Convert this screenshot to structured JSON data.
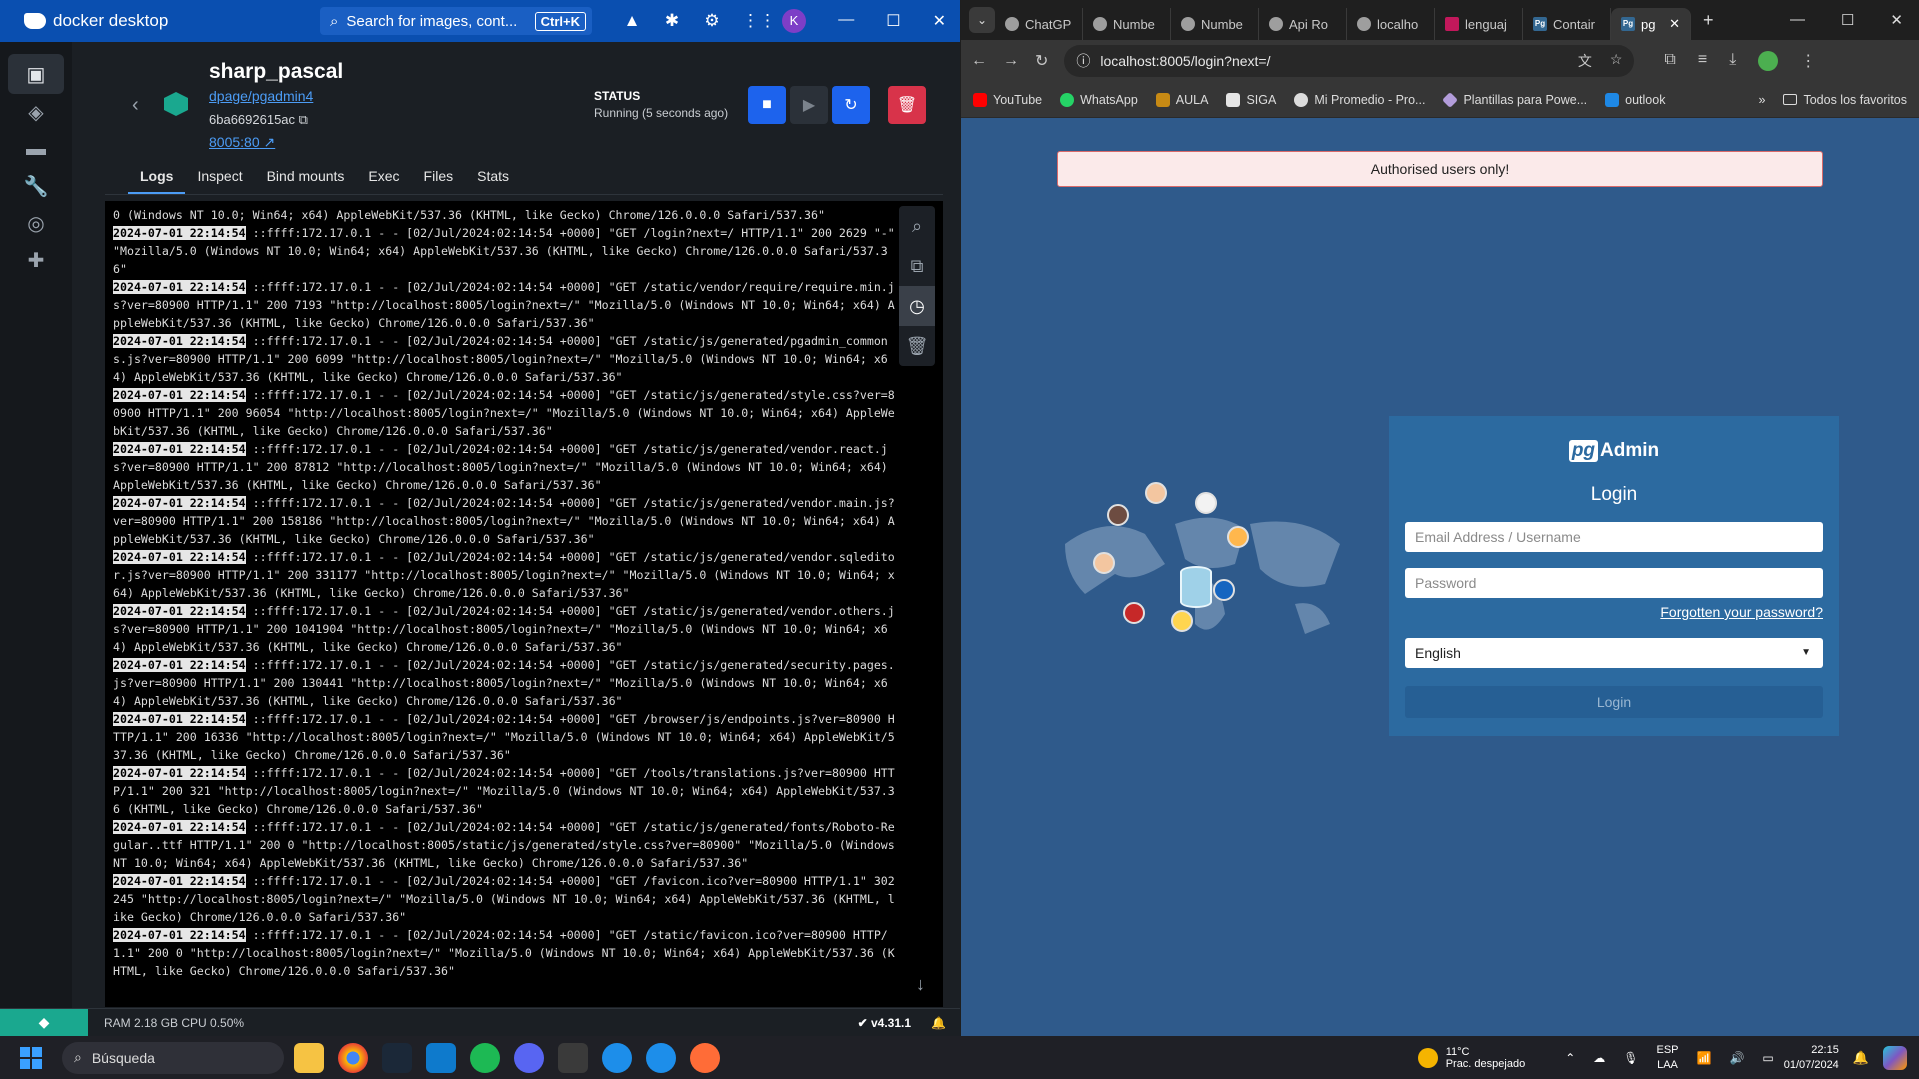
{
  "docker": {
    "brand": "docker desktop",
    "search_placeholder": "Search for images, cont...",
    "search_shortcut": "Ctrl+K",
    "avatar_letter": "K",
    "container": {
      "name": "sharp_pascal",
      "image_link": "dpage/pgadmin4",
      "id": "6ba6692615ac",
      "port_link": "8005:80",
      "status_label": "STATUS",
      "status_value": "Running (5 seconds ago)"
    },
    "tabs": [
      "Logs",
      "Inspect",
      "Bind mounts",
      "Exec",
      "Files",
      "Stats"
    ],
    "active_tab": "Logs",
    "log_prefix": "0 (Windows NT 10.0; Win64; x64) AppleWebKit/537.36 (KHTML, like Gecko) Chrome/126.0.0.0 Safari/537.36\"",
    "logs": [
      {
        "ts": "2024-07-01 22:14:54",
        "msg": " ::ffff:172.17.0.1 - - [02/Jul/2024:02:14:54 +0000] \"GET /login?next=/ HTTP/1.1\" 200 2629 \"-\" \"Mozilla/5.0 (Windows NT 10.0; Win64; x64) AppleWebKit/537.36 (KHTML, like Gecko) Chrome/126.0.0.0 Safari/537.36\""
      },
      {
        "ts": "2024-07-01 22:14:54",
        "msg": " ::ffff:172.17.0.1 - - [02/Jul/2024:02:14:54 +0000] \"GET /static/vendor/require/require.min.js?ver=80900 HTTP/1.1\" 200 7193 \"http://localhost:8005/login?next=/\" \"Mozilla/5.0 (Windows NT 10.0; Win64; x64) AppleWebKit/537.36 (KHTML, like Gecko) Chrome/126.0.0.0 Safari/537.36\""
      },
      {
        "ts": "2024-07-01 22:14:54",
        "msg": " ::ffff:172.17.0.1 - - [02/Jul/2024:02:14:54 +0000] \"GET /static/js/generated/pgadmin_commons.js?ver=80900 HTTP/1.1\" 200 6099 \"http://localhost:8005/login?next=/\" \"Mozilla/5.0 (Windows NT 10.0; Win64; x64) AppleWebKit/537.36 (KHTML, like Gecko) Chrome/126.0.0.0 Safari/537.36\""
      },
      {
        "ts": "2024-07-01 22:14:54",
        "msg": " ::ffff:172.17.0.1 - - [02/Jul/2024:02:14:54 +0000] \"GET /static/js/generated/style.css?ver=80900 HTTP/1.1\" 200 96054 \"http://localhost:8005/login?next=/\" \"Mozilla/5.0 (Windows NT 10.0; Win64; x64) AppleWebKit/537.36 (KHTML, like Gecko) Chrome/126.0.0.0 Safari/537.36\""
      },
      {
        "ts": "2024-07-01 22:14:54",
        "msg": " ::ffff:172.17.0.1 - - [02/Jul/2024:02:14:54 +0000] \"GET /static/js/generated/vendor.react.js?ver=80900 HTTP/1.1\" 200 87812 \"http://localhost:8005/login?next=/\" \"Mozilla/5.0 (Windows NT 10.0; Win64; x64) AppleWebKit/537.36 (KHTML, like Gecko) Chrome/126.0.0.0 Safari/537.36\""
      },
      {
        "ts": "2024-07-01 22:14:54",
        "msg": " ::ffff:172.17.0.1 - - [02/Jul/2024:02:14:54 +0000] \"GET /static/js/generated/vendor.main.js?ver=80900 HTTP/1.1\" 200 158186 \"http://localhost:8005/login?next=/\" \"Mozilla/5.0 (Windows NT 10.0; Win64; x64) AppleWebKit/537.36 (KHTML, like Gecko) Chrome/126.0.0.0 Safari/537.36\""
      },
      {
        "ts": "2024-07-01 22:14:54",
        "msg": " ::ffff:172.17.0.1 - - [02/Jul/2024:02:14:54 +0000] \"GET /static/js/generated/vendor.sqleditor.js?ver=80900 HTTP/1.1\" 200 331177 \"http://localhost:8005/login?next=/\" \"Mozilla/5.0 (Windows NT 10.0; Win64; x64) AppleWebKit/537.36 (KHTML, like Gecko) Chrome/126.0.0.0 Safari/537.36\""
      },
      {
        "ts": "2024-07-01 22:14:54",
        "msg": " ::ffff:172.17.0.1 - - [02/Jul/2024:02:14:54 +0000] \"GET /static/js/generated/vendor.others.js?ver=80900 HTTP/1.1\" 200 1041904 \"http://localhost:8005/login?next=/\" \"Mozilla/5.0 (Windows NT 10.0; Win64; x64) AppleWebKit/537.36 (KHTML, like Gecko) Chrome/126.0.0.0 Safari/537.36\""
      },
      {
        "ts": "2024-07-01 22:14:54",
        "msg": " ::ffff:172.17.0.1 - - [02/Jul/2024:02:14:54 +0000] \"GET /static/js/generated/security.pages.js?ver=80900 HTTP/1.1\" 200 130441 \"http://localhost:8005/login?next=/\" \"Mozilla/5.0 (Windows NT 10.0; Win64; x64) AppleWebKit/537.36 (KHTML, like Gecko) Chrome/126.0.0.0 Safari/537.36\""
      },
      {
        "ts": "2024-07-01 22:14:54",
        "msg": " ::ffff:172.17.0.1 - - [02/Jul/2024:02:14:54 +0000] \"GET /browser/js/endpoints.js?ver=80900 HTTP/1.1\" 200 16336 \"http://localhost:8005/login?next=/\" \"Mozilla/5.0 (Windows NT 10.0; Win64; x64) AppleWebKit/537.36 (KHTML, like Gecko) Chrome/126.0.0.0 Safari/537.36\""
      },
      {
        "ts": "2024-07-01 22:14:54",
        "msg": " ::ffff:172.17.0.1 - - [02/Jul/2024:02:14:54 +0000] \"GET /tools/translations.js?ver=80900 HTTP/1.1\" 200 321 \"http://localhost:8005/login?next=/\" \"Mozilla/5.0 (Windows NT 10.0; Win64; x64) AppleWebKit/537.36 (KHTML, like Gecko) Chrome/126.0.0.0 Safari/537.36\""
      },
      {
        "ts": "2024-07-01 22:14:54",
        "msg": " ::ffff:172.17.0.1 - - [02/Jul/2024:02:14:54 +0000] \"GET /static/js/generated/fonts/Roboto-Regular..ttf HTTP/1.1\" 200 0 \"http://localhost:8005/static/js/generated/style.css?ver=80900\" \"Mozilla/5.0 (Windows NT 10.0; Win64; x64) AppleWebKit/537.36 (KHTML, like Gecko) Chrome/126.0.0.0 Safari/537.36\""
      },
      {
        "ts": "2024-07-01 22:14:54",
        "msg": " ::ffff:172.17.0.1 - - [02/Jul/2024:02:14:54 +0000] \"GET /favicon.ico?ver=80900 HTTP/1.1\" 302 245 \"http://localhost:8005/login?next=/\" \"Mozilla/5.0 (Windows NT 10.0; Win64; x64) AppleWebKit/537.36 (KHTML, like Gecko) Chrome/126.0.0.0 Safari/537.36\""
      },
      {
        "ts": "2024-07-01 22:14:54",
        "msg": " ::ffff:172.17.0.1 - - [02/Jul/2024:02:14:54 +0000] \"GET /static/favicon.ico?ver=80900 HTTP/1.1\" 200 0 \"http://localhost:8005/login?next=/\" \"Mozilla/5.0 (Windows NT 10.0; Win64; x64) AppleWebKit/537.36 (KHTML, like Gecko) Chrome/126.0.0.0 Safari/537.36\""
      }
    ],
    "footer": {
      "resources": "RAM 2.18 GB  CPU 0.50%",
      "version": "v4.31.1"
    }
  },
  "chrome": {
    "tabs": [
      {
        "label": "ChatGP",
        "icon": "chatgpt-icon"
      },
      {
        "label": "Numbe",
        "icon": "globe-icon"
      },
      {
        "label": "Numbe",
        "icon": "globe-icon"
      },
      {
        "label": "Api Ro",
        "icon": "globe-icon"
      },
      {
        "label": "localho",
        "icon": "globe-icon"
      },
      {
        "label": "lenguaj",
        "icon": "pink-icon"
      },
      {
        "label": "Contair",
        "icon": "pgadmin-icon"
      },
      {
        "label": "pg",
        "icon": "pgadmin-icon"
      }
    ],
    "url": "localhost:8005/login?next=/",
    "bookmarks": [
      "YouTube",
      "WhatsApp",
      "AULA",
      "SIGA",
      "Mi Promedio - Pro...",
      "Plantillas para Powe...",
      "outlook"
    ],
    "all_bookmarks": "Todos los favoritos"
  },
  "pgadmin": {
    "alert": "Authorised users only!",
    "logo_pg": "pg",
    "logo_admin": "Admin",
    "title": "Login",
    "email_placeholder": "Email Address / Username",
    "password_placeholder": "Password",
    "forgot": "Forgotten your password?",
    "language": "English",
    "login_button": "Login",
    "colors": {
      "page": "#2f5a8b",
      "panel": "#2c6aa0",
      "button": "#265f94"
    }
  },
  "taskbar": {
    "search": "Búsqueda",
    "temp": "11°C",
    "weather": "Prac. despejado",
    "lang_top": "ESP",
    "lang_bottom": "LAA",
    "time": "22:15",
    "date": "01/07/2024"
  }
}
